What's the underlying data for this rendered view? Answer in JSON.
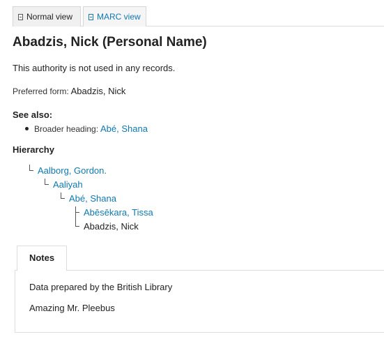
{
  "view_tabs": [
    {
      "label": "Normal view",
      "active": true
    },
    {
      "label": "MARC view",
      "active": false
    }
  ],
  "title": "Abadzis, Nick (Personal Name)",
  "usage_text": "This authority is not used in any records.",
  "preferred": {
    "label": "Preferred form:",
    "value": "Abadzis, Nick"
  },
  "see_also": {
    "heading": "See also:",
    "items": [
      {
        "label": "Broader heading:",
        "value": "Abé, Shana"
      }
    ]
  },
  "hierarchy": {
    "heading": "Hierarchy",
    "nodes": [
      {
        "label": "Aalborg, Gordon.",
        "link": true
      },
      {
        "label": "Aaliyah",
        "link": true
      },
      {
        "label": "Abé, Shana",
        "link": true
      },
      {
        "label": "Abēsēkara, Tissa",
        "link": true
      },
      {
        "label": "Abadzis, Nick",
        "link": false
      }
    ]
  },
  "notes": {
    "tab_label": "Notes",
    "lines": [
      "Data prepared by the British Library",
      "Amazing Mr. Pleebus"
    ]
  },
  "colors": {
    "link": "#0f78b0",
    "text": "#222222",
    "border": "#dddddd"
  }
}
